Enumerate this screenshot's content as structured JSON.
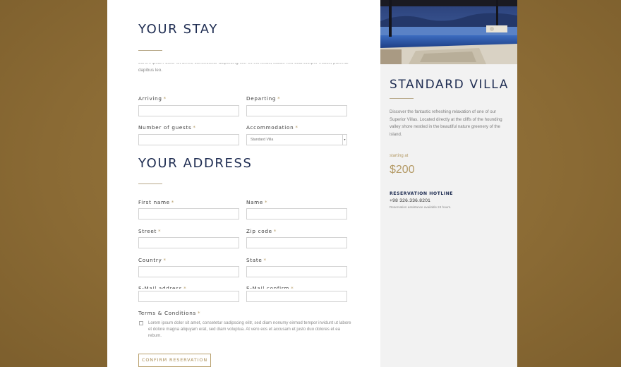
{
  "stay": {
    "heading": "YOUR STAY",
    "intro": "Lorem ipsum dolor sit amet, consectetur adipiscing elit. Ut elit tellus, luctus nec ullamcorper mattis, pulvinar dapibus leo.",
    "arriving_label": "Arriving",
    "departing_label": "Departing",
    "guests_label": "Number of guests",
    "accommodation_label": "Accommodation",
    "accommodation_value": "Standard Villa"
  },
  "address": {
    "heading": "YOUR ADDRESS",
    "first_name_label": "First name",
    "name_label": "Name",
    "street_label": "Street",
    "zip_label": "Zip code",
    "country_label": "Country",
    "state_label": "State",
    "email_label": "E-Mail address",
    "email_confirm_label": "E-Mail confirm",
    "terms_label": "Terms & Conditions",
    "terms_text": "Lorem ipsum dolor sit amet, consetetur sadipscing elitr, sed diam nonumy eirmod tempor invidunt ut labore et dolore magna aliquyam erat, sed diam voluptua. At vero eos et accusam et justo duo dolores et ea rebum.",
    "required_mark": "*",
    "confirm_button": "CONFIRM RESERVATION"
  },
  "villa": {
    "title": "STANDARD VILLA",
    "description": "Discover the fantastic refreshing relaxation of one of our Superior Villas. Located directly at the cliffs of the hounding valley shore nestled in the beautiful nature greenery of the island.",
    "starting_label": "starting at",
    "price": "$200",
    "hotline_label": "RESERVATION HOTLINE",
    "hotline_number": "+98 326.336.8201",
    "hotline_note": "Reservation assistance available 24 hours."
  },
  "colors": {
    "background": "#8a6a34",
    "navy": "#1f2d52",
    "gold": "#b49a66",
    "sidebar": "#f2f2f2"
  }
}
